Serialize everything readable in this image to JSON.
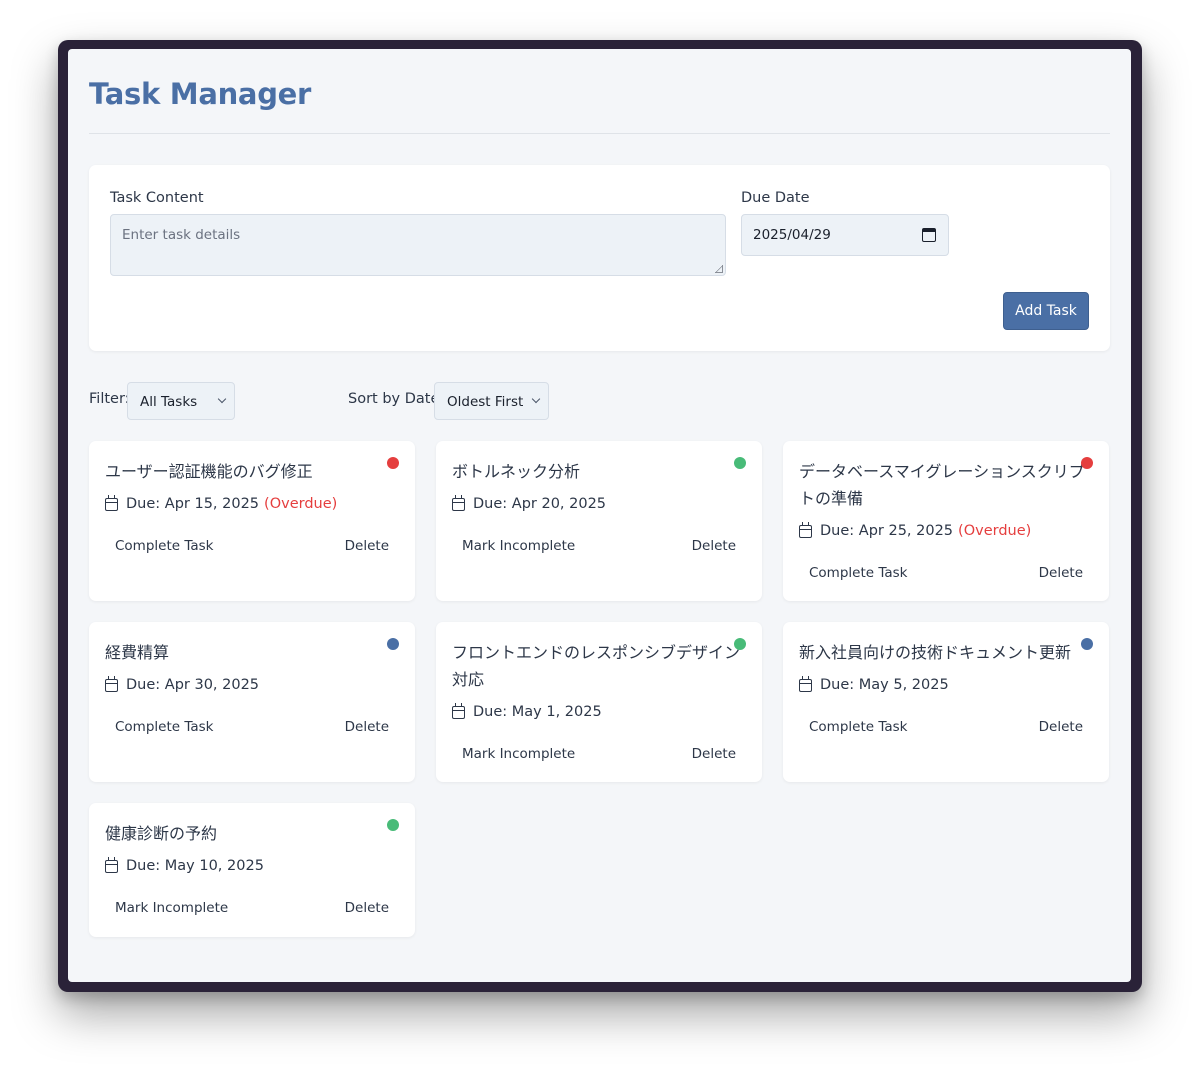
{
  "app": {
    "title": "Task Manager"
  },
  "form": {
    "content_label": "Task Content",
    "content_placeholder": "Enter task details",
    "date_label": "Due Date",
    "date_value": "2025/04/29",
    "add_button": "Add Task"
  },
  "controls": {
    "filter_label": "Filter:",
    "filter_value": "All Tasks",
    "sort_label": "Sort by Date:",
    "sort_value": "Oldest First"
  },
  "colors": {
    "accent": "#4a6fa5",
    "overdue": "#e53e3e",
    "completed": "#48bb78",
    "pending": "#4a6fa5"
  },
  "tasks": [
    {
      "title": "ユーザー認証機能のバグ修正",
      "due": "Due: Apr 15, 2025",
      "overdue": "(Overdue)",
      "status": "overdue",
      "action": "Complete Task",
      "delete": "Delete"
    },
    {
      "title": "ボトルネック分析",
      "due": "Due: Apr 20, 2025",
      "overdue": "",
      "status": "completed",
      "action": "Mark Incomplete",
      "delete": "Delete"
    },
    {
      "title": "データベースマイグレーションスクリプトの準備",
      "due": "Due: Apr 25, 2025",
      "overdue": "(Overdue)",
      "status": "overdue",
      "action": "Complete Task",
      "delete": "Delete"
    },
    {
      "title": "経費精算",
      "due": "Due: Apr 30, 2025",
      "overdue": "",
      "status": "pending",
      "action": "Complete Task",
      "delete": "Delete"
    },
    {
      "title": "フロントエンドのレスポンシブデザイン対応",
      "due": "Due: May 1, 2025",
      "overdue": "",
      "status": "completed",
      "action": "Mark Incomplete",
      "delete": "Delete"
    },
    {
      "title": "新入社員向けの技術ドキュメント更新",
      "due": "Due: May 5, 2025",
      "overdue": "",
      "status": "pending",
      "action": "Complete Task",
      "delete": "Delete"
    },
    {
      "title": "健康診断の予約",
      "due": "Due: May 10, 2025",
      "overdue": "",
      "status": "completed",
      "action": "Mark Incomplete",
      "delete": "Delete"
    }
  ]
}
